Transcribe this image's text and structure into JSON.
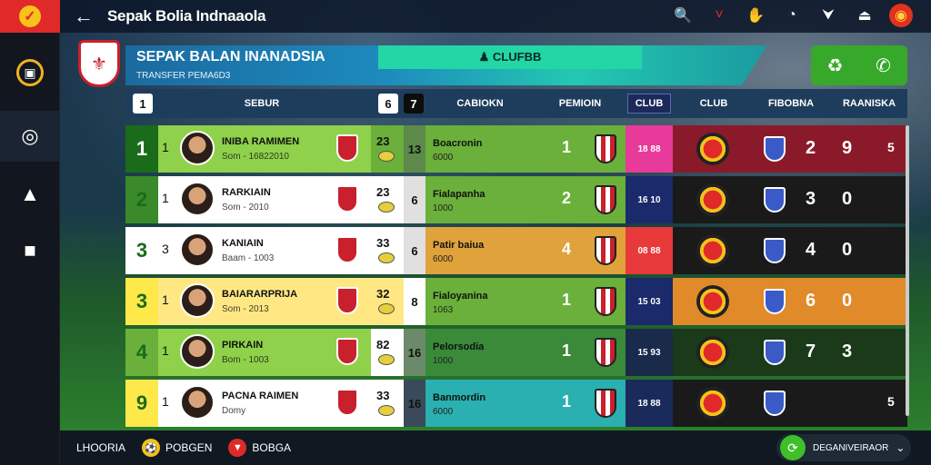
{
  "app": {
    "title": "Sepak Bolia Indnaaola"
  },
  "topbar": {
    "icons": [
      "search-icon",
      "chevron-icon",
      "hand-icon",
      "chat-icon",
      "inbox-icon",
      "alert-icon",
      "profile-icon"
    ]
  },
  "sidebar": {
    "items": [
      {
        "icon": "shop-icon"
      },
      {
        "icon": "whistle-icon"
      },
      {
        "icon": "cleat-icon"
      },
      {
        "icon": "team-icon"
      }
    ]
  },
  "banner": {
    "title": "SEPAK BALAN INANADSIA",
    "subtitle": "TRANSFER PEMA6D3",
    "tab_label": "♟ CLUFBB"
  },
  "table": {
    "headers": {
      "col1": "1",
      "col2": "SEBUR",
      "col3": "6",
      "col4": "7",
      "col5": "CABIOKN",
      "col6": "PEMIOIN",
      "col7": "CLUB",
      "col8": "CLUB",
      "col9": "FIBOBNA",
      "col10": "RAANISKA"
    },
    "rows": [
      {
        "rank": "1",
        "pos": "1",
        "name": "INIBA RAMIMEN",
        "sub": "Som - 16822010",
        "stat": "23",
        "num2": "13",
        "club": "Boacronin",
        "club_sub": "6000",
        "club_num": "1",
        "pct": "18 88",
        "v1": "2",
        "v2": "9",
        "v3": "5"
      },
      {
        "rank": "2",
        "pos": "1",
        "name": "RARKIAIN",
        "sub": "Som - 2010",
        "stat": "23",
        "num2": "6",
        "club": "Fialapanha",
        "club_sub": "1000",
        "club_num": "2",
        "pct": "16 10",
        "v1": "3",
        "v2": "0",
        "v3": ""
      },
      {
        "rank": "3",
        "pos": "3",
        "name": "KANIAIN",
        "sub": "Baam - 1003",
        "stat": "33",
        "num2": "6",
        "club": "Patir baiua",
        "club_sub": "6000",
        "club_num": "4",
        "pct": "08 88",
        "v1": "4",
        "v2": "0",
        "v3": ""
      },
      {
        "rank": "3",
        "pos": "1",
        "name": "BAIARARPRIJA",
        "sub": "Som - 2013",
        "stat": "32",
        "num2": "8",
        "club": "Fialoyanina",
        "club_sub": "1063",
        "club_num": "1",
        "pct": "15 03",
        "v1": "6",
        "v2": "0",
        "v3": ""
      },
      {
        "rank": "4",
        "pos": "1",
        "name": "PIRKAIN",
        "sub": "Bom - 1003",
        "stat": "82",
        "num2": "16",
        "club": "Pelorsodia",
        "club_sub": "1000",
        "club_num": "1",
        "pct": "15 93",
        "v1": "7",
        "v2": "3",
        "v3": ""
      },
      {
        "rank": "9",
        "pos": "1",
        "name": "PACNA RAIMEN",
        "sub": "Domy",
        "stat": "33",
        "num2": "16",
        "club": "Banmordin",
        "club_sub": "6000",
        "club_num": "1",
        "pct": "18 88",
        "v1": "",
        "v2": "",
        "v3": "5"
      }
    ]
  },
  "bottombar": {
    "item1": "LHOORIA",
    "item2": "POBGEN",
    "item3": "BOBGA",
    "right_label": "DEGANIVEIRAOR"
  },
  "colors": {
    "accent_red": "#e02a2a",
    "accent_green": "#36a92a",
    "banner_teal": "#22d6a6"
  }
}
